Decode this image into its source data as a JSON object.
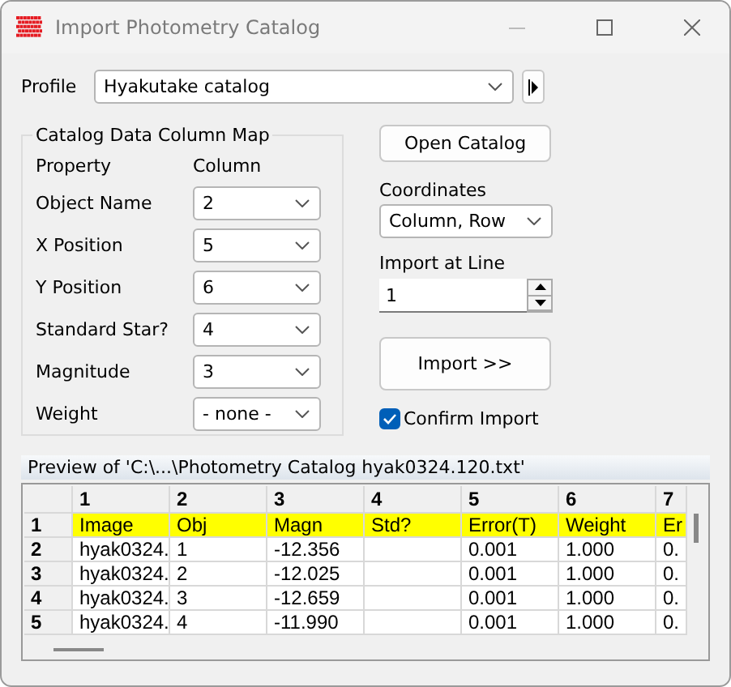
{
  "window": {
    "title": "Import Photometry Catalog"
  },
  "profile": {
    "label": "Profile",
    "value": "Hyakutake catalog"
  },
  "column_map": {
    "title": "Catalog Data Column Map",
    "headers": [
      "Property",
      "Column"
    ],
    "rows": [
      {
        "property": "Object Name",
        "column": "2"
      },
      {
        "property": "X Position",
        "column": "5"
      },
      {
        "property": "Y Position",
        "column": "6"
      },
      {
        "property": "Standard Star?",
        "column": "4"
      },
      {
        "property": "Magnitude",
        "column": "3"
      },
      {
        "property": "Weight",
        "column": "- none -"
      }
    ]
  },
  "open_button": "Open Catalog",
  "coordinates": {
    "label": "Coordinates",
    "value": "Column, Row"
  },
  "import_line": {
    "label": "Import at Line",
    "value": "1"
  },
  "import_button": "Import >>",
  "confirm_import": {
    "label": "Confirm Import",
    "checked": true
  },
  "preview": {
    "title": "Preview of 'C:\\...\\Photometry Catalog hyak0324.120.txt'",
    "columns": [
      "1",
      "2",
      "3",
      "4",
      "5",
      "6",
      "7"
    ],
    "rows": [
      {
        "label": "1",
        "highlighted": true,
        "cells": [
          "Image",
          "Obj",
          "Magn",
          "Std?",
          "Error(T)",
          "Weight",
          "Er"
        ]
      },
      {
        "label": "2",
        "highlighted": false,
        "cells": [
          "hyak0324.",
          "1",
          "-12.356",
          "",
          "0.001",
          "1.000",
          "0."
        ]
      },
      {
        "label": "3",
        "highlighted": false,
        "cells": [
          "hyak0324.",
          "2",
          "-12.025",
          "",
          "0.001",
          "1.000",
          "0."
        ]
      },
      {
        "label": "4",
        "highlighted": false,
        "cells": [
          "hyak0324.",
          "3",
          "-12.659",
          "",
          "0.001",
          "1.000",
          "0."
        ]
      },
      {
        "label": "5",
        "highlighted": false,
        "cells": [
          "hyak0324.",
          "4",
          "-11.990",
          "",
          "0.001",
          "1.000",
          "0."
        ]
      }
    ]
  }
}
